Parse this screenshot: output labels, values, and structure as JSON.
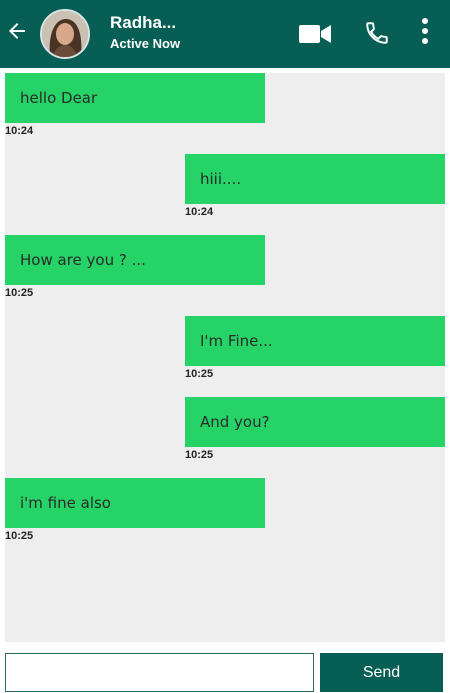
{
  "header": {
    "contact_name": "Radha...",
    "status": "Active Now",
    "icons": [
      "back-arrow-icon",
      "video-call-icon",
      "phone-call-icon",
      "more-vertical-icon"
    ],
    "accent_color": "#075e54"
  },
  "messages": [
    {
      "side": "received",
      "text": "hello Dear",
      "time": "10:24"
    },
    {
      "side": "sent",
      "text": "hiii....",
      "time": "10:24"
    },
    {
      "side": "received",
      "text": "How are you ? ...",
      "time": "10:25"
    },
    {
      "side": "sent",
      "text": "I'm Fine...",
      "time": "10:25"
    },
    {
      "side": "sent",
      "text": "And you?",
      "time": "10:25"
    },
    {
      "side": "received",
      "text": "i'm fine also",
      "time": "10:25"
    }
  ],
  "composer": {
    "value": "",
    "placeholder": "",
    "send_label": "Send"
  },
  "colors": {
    "bubble": "#25d366",
    "chat_background": "#eeeeee"
  }
}
